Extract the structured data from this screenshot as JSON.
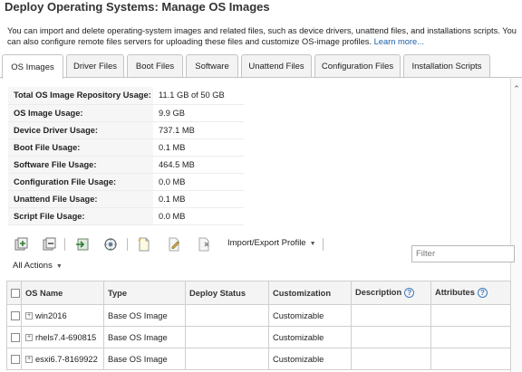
{
  "page": {
    "title": "Deploy Operating Systems: Manage OS Images",
    "intro_text": "You can import and delete operating-system images and related files, such as device drivers, unattend files, and installations scripts. You can also configure remote files servers for uploading these files and customize OS-image profiles.",
    "learn_more": "Learn more..."
  },
  "tabs": [
    {
      "label": "OS Images"
    },
    {
      "label": "Driver Files"
    },
    {
      "label": "Boot Files"
    },
    {
      "label": "Software"
    },
    {
      "label": "Unattend Files"
    },
    {
      "label": "Configuration Files"
    },
    {
      "label": "Installation Scripts"
    }
  ],
  "active_tab": "OS Images",
  "usage": [
    {
      "label": "Total OS Image Repository Usage:",
      "value": "11.1 GB of 50 GB"
    },
    {
      "label": "OS Image Usage:",
      "value": "9.9 GB"
    },
    {
      "label": "Device Driver Usage:",
      "value": "737.1 MB"
    },
    {
      "label": "Boot File Usage:",
      "value": "0.1 MB"
    },
    {
      "label": "Software File Usage:",
      "value": "464.5 MB"
    },
    {
      "label": "Configuration File Usage:",
      "value": "0.0 MB"
    },
    {
      "label": "Unattend File Usage:",
      "value": "0.1 MB"
    },
    {
      "label": "Script File Usage:",
      "value": "0.0 MB"
    }
  ],
  "toolbar": {
    "import_export_label": "Import/Export Profile",
    "all_actions_label": "All Actions",
    "icons": [
      "add-icon",
      "remove-icon",
      "deploy-icon",
      "refresh-settings-icon",
      "new-profile-icon",
      "edit-icon",
      "delete-icon"
    ]
  },
  "filter": {
    "placeholder": "Filter",
    "value": ""
  },
  "grid": {
    "columns": [
      "OS Name",
      "Type",
      "Deploy Status",
      "Customization",
      "Description",
      "Attributes"
    ],
    "rows": [
      {
        "name": "win2016",
        "type": "Base OS Image",
        "deploy_status": "",
        "customization": "Customizable",
        "description": "",
        "attributes": ""
      },
      {
        "name": "rhels7.4-690815",
        "type": "Base OS Image",
        "deploy_status": "",
        "customization": "Customizable",
        "description": "",
        "attributes": ""
      },
      {
        "name": "esxi6.7-8169922",
        "type": "Base OS Image",
        "deploy_status": "",
        "customization": "Customizable",
        "description": "",
        "attributes": ""
      }
    ]
  },
  "colors": {
    "link": "#1a5ea8",
    "help": "#3f7bbf",
    "border": "#cfcfcf"
  }
}
